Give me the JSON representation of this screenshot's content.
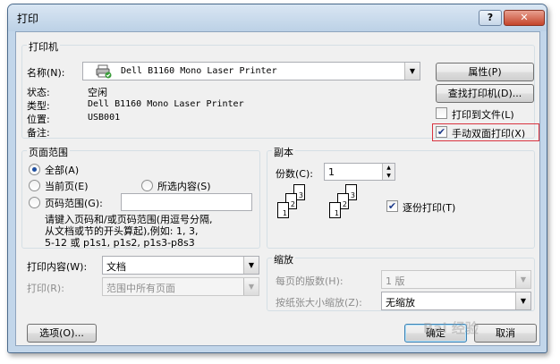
{
  "window": {
    "title": "打印",
    "help_label": "?",
    "close_label": "✕"
  },
  "printer": {
    "group_title": "打印机",
    "name_label": "名称(N):",
    "name_value": "Dell B1160 Mono Laser Printer",
    "status_label": "状态:",
    "status_value": "空闲",
    "type_label": "类型:",
    "type_value": "Dell B1160 Mono Laser Printer",
    "where_label": "位置:",
    "where_value": "USB001",
    "comment_label": "备注:",
    "properties_button": "属性(P)",
    "find_printer_button": "查找打印机(D)...",
    "print_to_file_label": "打印到文件(L)",
    "print_to_file_checked": false,
    "manual_duplex_label": "手动双面打印(X)",
    "manual_duplex_checked": true
  },
  "page_range": {
    "group_title": "页面范围",
    "all_label": "全部(A)",
    "current_label": "当前页(E)",
    "selection_label": "所选内容(S)",
    "pages_label": "页码范围(G):",
    "pages_value": "",
    "hint_line1": "请键入页码和/或页码范围(用逗号分隔,",
    "hint_line2": "从文档或节的开头算起),例如: 1, 3,",
    "hint_line3": "5-12 或 p1s1, p1s2, p1s3-p8s3",
    "selected": "all"
  },
  "copies": {
    "group_title": "副本",
    "count_label": "份数(C):",
    "count_value": "1",
    "collate_label": "逐份打印(T)",
    "collate_checked": true
  },
  "print_what": {
    "label": "打印内容(W):",
    "value": "文档",
    "print_label": "打印(R):",
    "print_value": "范围中所有页面"
  },
  "zoom": {
    "group_title": "缩放",
    "pages_per_sheet_label": "每页的版数(H):",
    "pages_per_sheet_value": "1 版",
    "scale_label": "按纸张大小缩放(Z):",
    "scale_value": "无缩放"
  },
  "footer": {
    "options_button": "选项(O)...",
    "ok_button": "确定",
    "cancel_button": "取消"
  },
  "icons": {
    "checkmark": "✔",
    "dropdown": "▼",
    "spin_up": "▲",
    "spin_down": "▼"
  },
  "watermark_text": "Bai 经验",
  "accent_color": "#d9333f"
}
